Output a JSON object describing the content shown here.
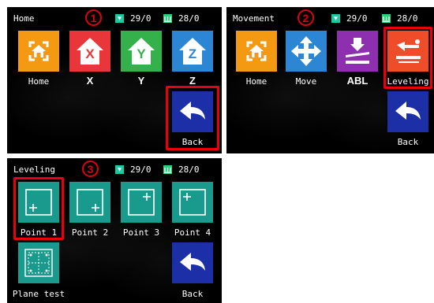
{
  "screens": [
    {
      "title": "Home",
      "step": "1",
      "temp1": "29/0",
      "temp2": "28/0",
      "tiles": [
        "Home",
        "X",
        "Y",
        "Z",
        "Back"
      ],
      "axis_letters": [
        "X",
        "Y",
        "Z"
      ]
    },
    {
      "title": "Movement",
      "step": "2",
      "temp1": "29/0",
      "temp2": "28/0",
      "tiles": [
        "Home",
        "Move",
        "ABL",
        "Leveling",
        "Back"
      ]
    },
    {
      "title": "Leveling",
      "step": "3",
      "temp1": "29/0",
      "temp2": "28/0",
      "tiles": [
        "Point 1",
        "Point 2",
        "Point 3",
        "Point 4",
        "Plane test",
        "Back"
      ]
    }
  ],
  "colors": {
    "highlight": "#e8000f",
    "nozzle_icon": "#1ec8a0",
    "bed_icon": "#2fd07a"
  },
  "icons": {
    "nozzle": "hotend-temp-icon",
    "bed": "heated-bed-icon",
    "home": "home-target-icon",
    "axis": "house-axis-icon",
    "move": "four-way-arrow-icon",
    "abl": "auto-bed-leveling-icon",
    "leveling": "leveling-tool-icon",
    "point": "level-point-icon",
    "plane": "plane-test-grid-icon",
    "back": "back-arrow-icon"
  }
}
